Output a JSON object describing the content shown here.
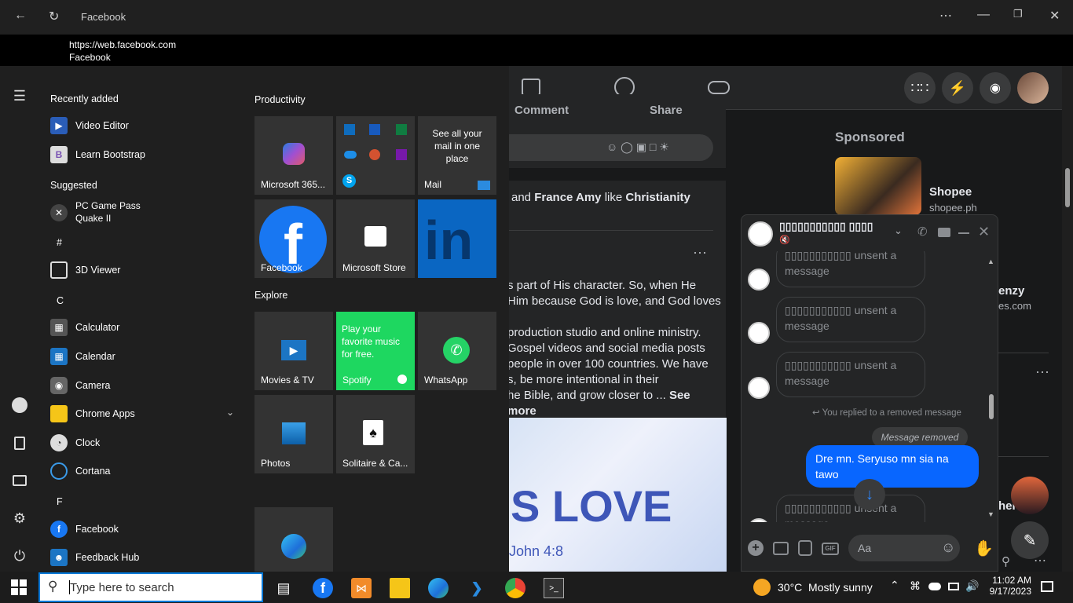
{
  "window": {
    "title": "Facebook"
  },
  "address": {
    "url": "https://web.facebook.com",
    "page_title": "Facebook"
  },
  "start_menu": {
    "recently_added_header": "Recently added",
    "recently_added": [
      "Video Editor",
      "Learn Bootstrap"
    ],
    "suggested_header": "Suggested",
    "suggested": [
      "PC Game Pass",
      "Quake II"
    ],
    "letters": [
      "#",
      "C",
      "F"
    ],
    "apps_hash": [
      "3D Viewer"
    ],
    "apps_c": [
      "Calculator",
      "Calendar",
      "Camera",
      "Chrome Apps",
      "Clock",
      "Cortana"
    ],
    "apps_f": [
      "Facebook",
      "Feedback Hub"
    ],
    "groups": [
      "Productivity",
      "Explore"
    ],
    "tiles": {
      "m365": "Microsoft 365...",
      "mail_promo": "See all your mail in one place",
      "mail": "Mail",
      "facebook": "Facebook",
      "store": "Microsoft Store",
      "movies": "Movies & TV",
      "spotify_promo": "Play your favorite music for free.",
      "spotify": "Spotify",
      "whatsapp": "WhatsApp",
      "photos": "Photos",
      "solitaire": "Solitaire & Ca..."
    }
  },
  "feed": {
    "comment": "Comment",
    "share": "Share",
    "like_line_prefix": "and",
    "like_name": "France Amy",
    "like_mid": "like",
    "like_page": "Christianity",
    "post_lines": [
      "s part of His character. So, when He",
      "Him because God is love, and God loves",
      "",
      "production studio and online ministry.",
      "Gospel videos and social media posts",
      "people in over 100 countries. We have",
      "s, be more intentional in their",
      "he Bible, and grow closer to ..."
    ],
    "see_more": "See more",
    "image_text": "S LOVE",
    "image_ref": "John 4:8"
  },
  "sponsored": {
    "header": "Sponsored",
    "ad_title": "Shopee",
    "ad_url": "shopee.ph",
    "ad2_partial": "enzy",
    "ad2_url_partial": "es.com",
    "contact_partial": "her"
  },
  "chat": {
    "name": "▯▯▯▯▯▯▯▯▯▯▯ ▯▯▯▯",
    "unsent": "▯▯▯▯▯▯▯▯▯▯▯ unsent a message",
    "replied_note": "You replied to a removed message",
    "removed": "Message removed",
    "my_message": "Dre mn. Seryuso mn sia na tawo",
    "input_placeholder": "Aa"
  },
  "taskbar": {
    "search_placeholder": "Type here to search",
    "weather": "30°C  Mostly sunny",
    "time": "11:02 AM",
    "date": "9/17/2023"
  }
}
